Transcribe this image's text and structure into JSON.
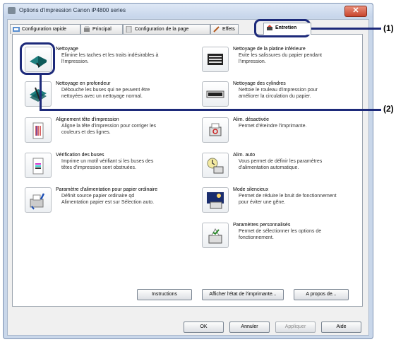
{
  "window": {
    "title": "Options d'impression Canon iP4800 series",
    "close_label": "✕"
  },
  "tabs": [
    {
      "label": "Configuration rapide",
      "icon": "quick-setup-icon"
    },
    {
      "label": "Principal",
      "icon": "main-icon"
    },
    {
      "label": "Configuration de la page",
      "icon": "page-setup-icon"
    },
    {
      "label": "Effets",
      "icon": "effects-icon"
    },
    {
      "label": "Entretien",
      "icon": "maintenance-icon"
    }
  ],
  "items": [
    {
      "name": "Nettoyage",
      "desc": "Elimine les taches et les traits indésirables à l'impression.",
      "icon": "cleaning-icon"
    },
    {
      "name": "Nettoyage en profondeur",
      "desc": "Débouche les buses qui ne peuvent être nettoyées avec un nettoyage normal.",
      "icon": "deep-cleaning-icon"
    },
    {
      "name": "Alignement tête d'impression",
      "desc": "Aligne la tête d'impression pour corriger les couleurs et des lignes.",
      "icon": "head-alignment-icon"
    },
    {
      "name": "Vérification des buses",
      "desc": "Imprime un motif vérifiant si les buses des têtes d'impression sont obstruées.",
      "icon": "nozzle-check-icon"
    },
    {
      "name": "Paramètre d'alimentation pour papier ordinaire",
      "desc": "Définit source papier ordinaire qd Alimentation papier est sur Sélection auto.",
      "icon": "paper-feed-icon"
    },
    {
      "name": "Nettoyage de la platine inférieure",
      "desc": "Evite les salissures du papier pendant l'impression.",
      "icon": "bottom-plate-cleaning-icon"
    },
    {
      "name": "Nettoyage des cylindres",
      "desc": "Nettoie le rouleau d'impression pour améliorer la circulation du papier.",
      "icon": "roller-cleaning-icon"
    },
    {
      "name": "Alim. désactivée",
      "desc": "Permet d'éteindre l'imprimante.",
      "icon": "power-off-icon"
    },
    {
      "name": "Alim. auto",
      "desc": "Vous permet de définir les paramètres d'alimentation automatique.",
      "icon": "auto-power-icon"
    },
    {
      "name": "Mode silencieux",
      "desc": "Permet de réduire le bruit de fonctionnement pour éviter une gêne.",
      "icon": "quiet-mode-icon"
    },
    {
      "name": "Paramètres personnalisés",
      "desc": "Permet de sélectionner les options de fonctionnement.",
      "icon": "custom-settings-icon"
    }
  ],
  "panel_buttons": {
    "instructions": "Instructions",
    "status": "Afficher l'état de l'imprimante...",
    "about": "A propos de..."
  },
  "dialog_buttons": {
    "ok": "OK",
    "cancel": "Annuler",
    "apply": "Appliquer",
    "help": "Aide"
  },
  "callouts": {
    "one": "(1)",
    "two": "(2)"
  },
  "colors": {
    "callout": "#1d2a7a",
    "title_bar": "#c9d7ea",
    "close_button": "#c8452e"
  }
}
